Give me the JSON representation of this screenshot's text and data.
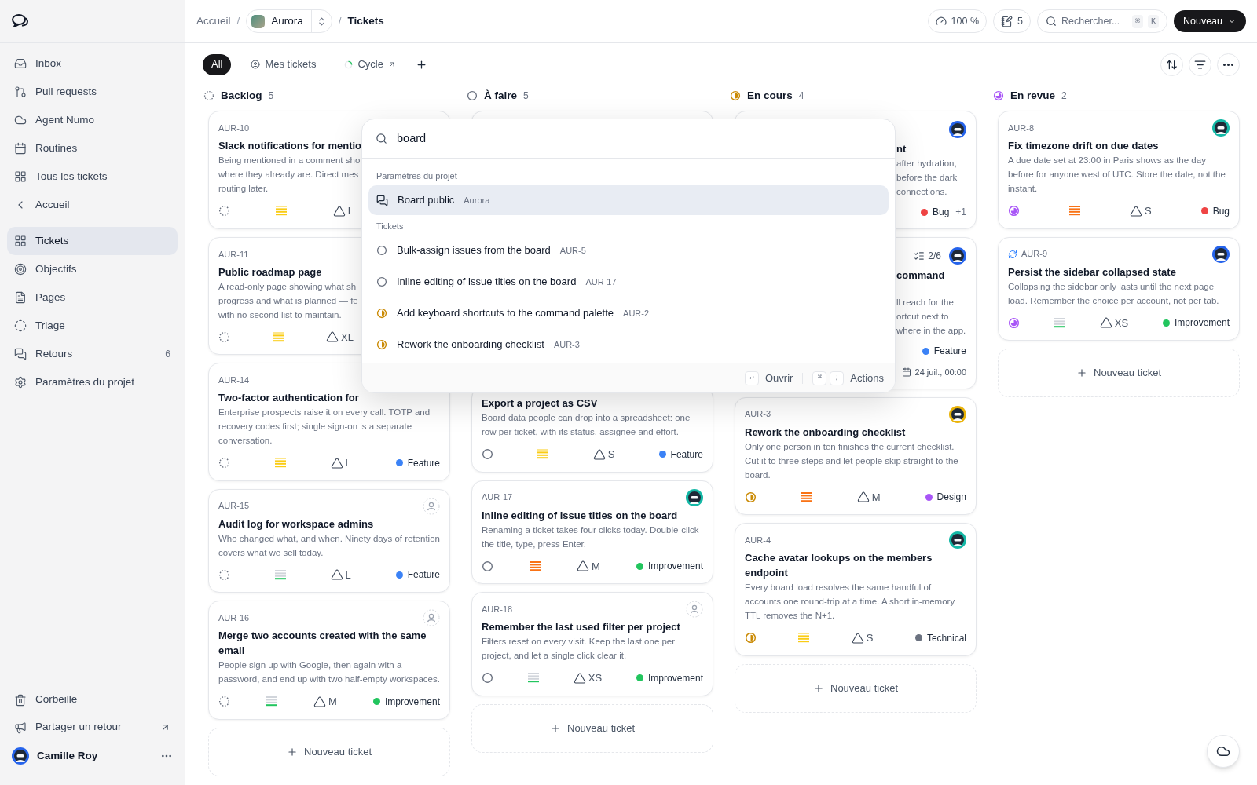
{
  "sidebar": {
    "groups": [
      {
        "items": [
          {
            "label": "Inbox",
            "selected": false
          },
          {
            "label": "Pull requests",
            "selected": false
          },
          {
            "label": "Agent Numo",
            "selected": false
          },
          {
            "label": "Routines",
            "selected": false
          },
          {
            "label": "Tous les tickets",
            "selected": false
          },
          {
            "label": "Accueil",
            "selected": false
          }
        ]
      },
      {
        "items": [
          {
            "label": "Tickets",
            "selected": true
          },
          {
            "label": "Objectifs",
            "selected": false
          },
          {
            "label": "Pages",
            "selected": false
          },
          {
            "label": "Triage",
            "selected": false
          },
          {
            "label": "Retours",
            "selected": false,
            "count": "6"
          },
          {
            "label": "Paramètres du projet",
            "selected": false
          }
        ]
      }
    ],
    "bottom": [
      {
        "label": "Corbeille"
      },
      {
        "label": "Partager un retour"
      }
    ],
    "user": {
      "name": "Camille Roy",
      "color": "#2563eb"
    }
  },
  "topbar": {
    "breadcrumb": [
      {
        "kind": "link",
        "label": "Accueil"
      },
      {
        "kind": "separator",
        "label": "/"
      },
      {
        "kind": "project",
        "label": "Aurora"
      },
      {
        "kind": "separator",
        "label": "/"
      },
      {
        "kind": "current",
        "label": "Tickets"
      }
    ],
    "zoom": "100 %",
    "notes": "5",
    "search": {
      "placeholder": "Rechercher...",
      "keys": [
        "⌘",
        "K"
      ]
    },
    "new_button": "Nouveau"
  },
  "tabs": [
    {
      "label": "All",
      "selected": true
    },
    {
      "label": "Mes tickets",
      "selected": false
    },
    {
      "label": "Cycle",
      "selected": false
    }
  ],
  "columns": [
    {
      "status": {
        "kind": "backlog"
      },
      "title": "Backlog",
      "count": "5",
      "add_label": "Nouveau ticket",
      "cards": [
        {
          "kind": "clipped_right",
          "id": "AUR-10",
          "title": "Slack notifications for mentio",
          "lines": [
            "Being mentioned in a comment sho",
            "where they already are. Direct mes",
            "routing later."
          ],
          "status": {
            "kind": "backlog"
          },
          "priority": {
            "kind": "medium"
          },
          "size": "L"
        },
        {
          "kind": "clipped_right",
          "id": "AUR-11",
          "title": "Public roadmap page",
          "lines": [
            "A read-only page showing what sh",
            "progress and what is planned — fe",
            "with no second list to maintain."
          ],
          "status": {
            "kind": "backlog"
          },
          "priority": {
            "kind": "medium"
          },
          "size": "XL"
        },
        {
          "kind": "full",
          "id": "AUR-14",
          "synced": false,
          "title": "Two-factor authentication for",
          "description": "Enterprise prospects raise it on every call. TOTP and recovery codes first; single sign-on is a separate conversation.",
          "status": {
            "kind": "backlog"
          },
          "priority": {
            "kind": "medium"
          },
          "size": "L",
          "tag": {
            "label": "Feature",
            "color": "#3b82f6"
          }
        },
        {
          "kind": "full",
          "id": "AUR-15",
          "synced": false,
          "assignee": {
            "kind": "unassigned"
          },
          "title": "Audit log for workspace admins",
          "description": "Who changed what, and when. Ninety days of retention covers what we sell today.",
          "status": {
            "kind": "backlog"
          },
          "priority": {
            "kind": "low"
          },
          "size": "L",
          "tag": {
            "label": "Feature",
            "color": "#3b82f6"
          }
        },
        {
          "kind": "full",
          "id": "AUR-16",
          "synced": false,
          "assignee": {
            "kind": "unassigned"
          },
          "title": "Merge two accounts created with the same email",
          "description": "People sign up with Google, then again with a password, and end up with two half-empty workspaces.",
          "status": {
            "kind": "backlog"
          },
          "priority": {
            "kind": "low"
          },
          "size": "M",
          "tag": {
            "label": "Improvement",
            "color": "#22c55e"
          }
        }
      ]
    },
    {
      "status": {
        "kind": "todo"
      },
      "title": "À faire",
      "count": "5",
      "add_label": "Nouveau ticket",
      "cards": [
        {
          "kind": "hidden"
        },
        {
          "kind": "clipped_top",
          "title": "Export a project as CSV",
          "description": "Board data people can drop into a spreadsheet: one row per ticket, with its status, assignee and effort.",
          "status": {
            "kind": "todo"
          },
          "priority": {
            "kind": "medium"
          },
          "size": "S",
          "tag": {
            "label": "Feature",
            "color": "#3b82f6"
          }
        },
        {
          "kind": "full",
          "id": "AUR-17",
          "synced": false,
          "assignee": {
            "kind": "person",
            "color": "#14b8a6"
          },
          "title": "Inline editing of issue titles on the board",
          "description": "Renaming a ticket takes four clicks today. Double-click the title, type, press Enter.",
          "status": {
            "kind": "todo"
          },
          "priority": {
            "kind": "high"
          },
          "size": "M",
          "tag": {
            "label": "Improvement",
            "color": "#22c55e"
          }
        },
        {
          "kind": "full",
          "id": "AUR-18",
          "synced": false,
          "assignee": {
            "kind": "unassigned"
          },
          "title": "Remember the last used filter per project",
          "description": "Filters reset on every visit. Keep the last one per project, and let a single click clear it.",
          "status": {
            "kind": "todo"
          },
          "priority": {
            "kind": "low"
          },
          "size": "XS",
          "tag": {
            "label": "Improvement",
            "color": "#22c55e"
          }
        }
      ]
    },
    {
      "status": {
        "kind": "in_progress"
      },
      "title": "En cours",
      "count": "4",
      "add_label": "Nouveau ticket",
      "cards": [
        {
          "kind": "clipped_left",
          "assignee": {
            "kind": "person",
            "color": "#2563eb"
          },
          "title": "nt",
          "lines": [
            "after hydration,",
            "before the dark",
            "connections."
          ],
          "tag": {
            "label": "Bug",
            "color": "#ef4444"
          },
          "extra": "+1"
        },
        {
          "kind": "clipped_left",
          "checklist": "2/6",
          "assignee": {
            "kind": "person",
            "color": "#2563eb"
          },
          "title": "command",
          "lines": [
            "ll reach for the",
            "ortcut next to",
            "where in the app."
          ],
          "tag": {
            "label": "Feature",
            "color": "#3b82f6"
          },
          "due": "24 juil., 00:00"
        },
        {
          "kind": "full",
          "id": "AUR-3",
          "synced": false,
          "assignee": {
            "kind": "person",
            "color": "#eab308"
          },
          "title": "Rework the onboarding checklist",
          "description": "Only one person in ten finishes the current checklist. Cut it to three steps and let people skip straight to the board.",
          "status": {
            "kind": "in_progress"
          },
          "priority": {
            "kind": "high"
          },
          "size": "M",
          "tag": {
            "label": "Design",
            "color": "#a855f7"
          }
        },
        {
          "kind": "full",
          "id": "AUR-4",
          "synced": false,
          "assignee": {
            "kind": "person",
            "color": "#14b8a6"
          },
          "title": "Cache avatar lookups on the members endpoint",
          "description": "Every board load resolves the same handful of accounts one round-trip at a time. A short in-memory TTL removes the N+1.",
          "status": {
            "kind": "in_progress"
          },
          "priority": {
            "kind": "medium"
          },
          "size": "S",
          "tag": {
            "label": "Technical",
            "color": "#6b7280"
          }
        }
      ]
    },
    {
      "status": {
        "kind": "in_review"
      },
      "title": "En revue",
      "count": "2",
      "add_label": "Nouveau ticket",
      "cards": [
        {
          "kind": "full",
          "id": "AUR-8",
          "synced": false,
          "assignee": {
            "kind": "person",
            "color": "#14b8a6"
          },
          "title": "Fix timezone drift on due dates",
          "description": "A due date set at 23:00 in Paris shows as the day before for anyone west of UTC. Store the date, not the instant.",
          "status": {
            "kind": "in_review"
          },
          "priority": {
            "kind": "high"
          },
          "size": "S",
          "tag": {
            "label": "Bug",
            "color": "#ef4444"
          }
        },
        {
          "kind": "full",
          "id": "AUR-9",
          "synced": true,
          "assignee": {
            "kind": "person",
            "color": "#2563eb"
          },
          "title": "Persist the sidebar collapsed state",
          "description": "Collapsing the sidebar only lasts until the next page load. Remember the choice per account, not per tab.",
          "status": {
            "kind": "in_review"
          },
          "priority": {
            "kind": "low"
          },
          "size": "XS",
          "tag": {
            "label": "Improvement",
            "color": "#22c55e"
          }
        }
      ]
    }
  ],
  "palette": {
    "query": "board",
    "sections": [
      {
        "title": "Paramètres du projet",
        "items": [
          {
            "kind": "setting",
            "label": "Board public",
            "meta": "Aurora",
            "selected": true
          }
        ]
      },
      {
        "title": "Tickets",
        "items": [
          {
            "kind": "ticket",
            "status": {
              "kind": "todo"
            },
            "label": "Bulk-assign issues from the board",
            "meta": "AUR-5",
            "selected": false
          },
          {
            "kind": "ticket",
            "status": {
              "kind": "todo"
            },
            "label": "Inline editing of issue titles on the board",
            "meta": "AUR-17",
            "selected": false
          },
          {
            "kind": "ticket",
            "status": {
              "kind": "in_progress"
            },
            "label": "Add keyboard shortcuts to the command palette",
            "meta": "AUR-2",
            "selected": false
          },
          {
            "kind": "ticket",
            "status": {
              "kind": "in_progress"
            },
            "label": "Rework the onboarding checklist",
            "meta": "AUR-3",
            "selected": false
          }
        ]
      }
    ],
    "footer": [
      {
        "keys": [
          "↵"
        ],
        "label": "Ouvrir"
      },
      {
        "keys": [
          "⌘",
          ";"
        ],
        "label": "Actions"
      }
    ]
  }
}
